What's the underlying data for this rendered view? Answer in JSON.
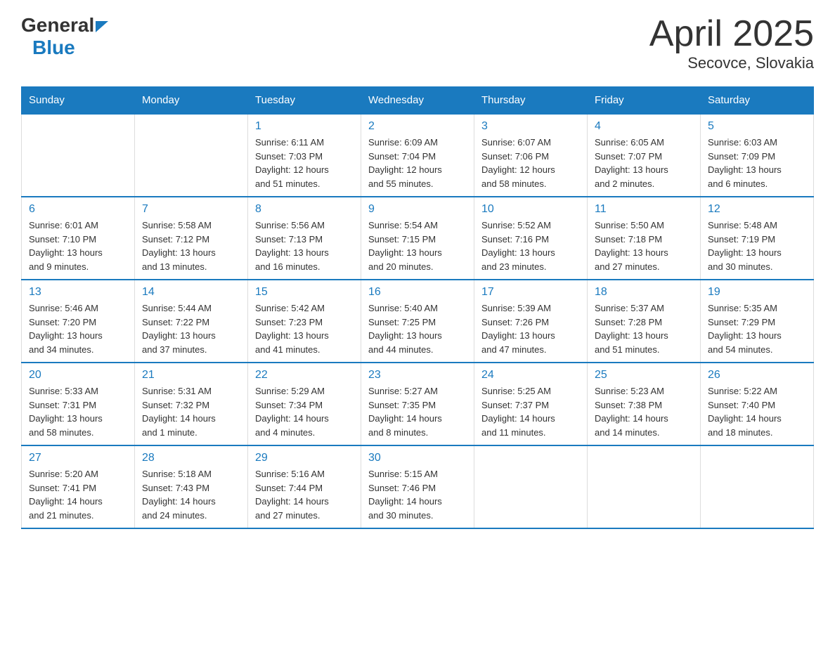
{
  "header": {
    "title": "April 2025",
    "subtitle": "Secovce, Slovakia",
    "logo_general": "General",
    "logo_blue": "Blue"
  },
  "days_of_week": [
    "Sunday",
    "Monday",
    "Tuesday",
    "Wednesday",
    "Thursday",
    "Friday",
    "Saturday"
  ],
  "weeks": [
    [
      {
        "day": "",
        "info": ""
      },
      {
        "day": "",
        "info": ""
      },
      {
        "day": "1",
        "info": "Sunrise: 6:11 AM\nSunset: 7:03 PM\nDaylight: 12 hours\nand 51 minutes."
      },
      {
        "day": "2",
        "info": "Sunrise: 6:09 AM\nSunset: 7:04 PM\nDaylight: 12 hours\nand 55 minutes."
      },
      {
        "day": "3",
        "info": "Sunrise: 6:07 AM\nSunset: 7:06 PM\nDaylight: 12 hours\nand 58 minutes."
      },
      {
        "day": "4",
        "info": "Sunrise: 6:05 AM\nSunset: 7:07 PM\nDaylight: 13 hours\nand 2 minutes."
      },
      {
        "day": "5",
        "info": "Sunrise: 6:03 AM\nSunset: 7:09 PM\nDaylight: 13 hours\nand 6 minutes."
      }
    ],
    [
      {
        "day": "6",
        "info": "Sunrise: 6:01 AM\nSunset: 7:10 PM\nDaylight: 13 hours\nand 9 minutes."
      },
      {
        "day": "7",
        "info": "Sunrise: 5:58 AM\nSunset: 7:12 PM\nDaylight: 13 hours\nand 13 minutes."
      },
      {
        "day": "8",
        "info": "Sunrise: 5:56 AM\nSunset: 7:13 PM\nDaylight: 13 hours\nand 16 minutes."
      },
      {
        "day": "9",
        "info": "Sunrise: 5:54 AM\nSunset: 7:15 PM\nDaylight: 13 hours\nand 20 minutes."
      },
      {
        "day": "10",
        "info": "Sunrise: 5:52 AM\nSunset: 7:16 PM\nDaylight: 13 hours\nand 23 minutes."
      },
      {
        "day": "11",
        "info": "Sunrise: 5:50 AM\nSunset: 7:18 PM\nDaylight: 13 hours\nand 27 minutes."
      },
      {
        "day": "12",
        "info": "Sunrise: 5:48 AM\nSunset: 7:19 PM\nDaylight: 13 hours\nand 30 minutes."
      }
    ],
    [
      {
        "day": "13",
        "info": "Sunrise: 5:46 AM\nSunset: 7:20 PM\nDaylight: 13 hours\nand 34 minutes."
      },
      {
        "day": "14",
        "info": "Sunrise: 5:44 AM\nSunset: 7:22 PM\nDaylight: 13 hours\nand 37 minutes."
      },
      {
        "day": "15",
        "info": "Sunrise: 5:42 AM\nSunset: 7:23 PM\nDaylight: 13 hours\nand 41 minutes."
      },
      {
        "day": "16",
        "info": "Sunrise: 5:40 AM\nSunset: 7:25 PM\nDaylight: 13 hours\nand 44 minutes."
      },
      {
        "day": "17",
        "info": "Sunrise: 5:39 AM\nSunset: 7:26 PM\nDaylight: 13 hours\nand 47 minutes."
      },
      {
        "day": "18",
        "info": "Sunrise: 5:37 AM\nSunset: 7:28 PM\nDaylight: 13 hours\nand 51 minutes."
      },
      {
        "day": "19",
        "info": "Sunrise: 5:35 AM\nSunset: 7:29 PM\nDaylight: 13 hours\nand 54 minutes."
      }
    ],
    [
      {
        "day": "20",
        "info": "Sunrise: 5:33 AM\nSunset: 7:31 PM\nDaylight: 13 hours\nand 58 minutes."
      },
      {
        "day": "21",
        "info": "Sunrise: 5:31 AM\nSunset: 7:32 PM\nDaylight: 14 hours\nand 1 minute."
      },
      {
        "day": "22",
        "info": "Sunrise: 5:29 AM\nSunset: 7:34 PM\nDaylight: 14 hours\nand 4 minutes."
      },
      {
        "day": "23",
        "info": "Sunrise: 5:27 AM\nSunset: 7:35 PM\nDaylight: 14 hours\nand 8 minutes."
      },
      {
        "day": "24",
        "info": "Sunrise: 5:25 AM\nSunset: 7:37 PM\nDaylight: 14 hours\nand 11 minutes."
      },
      {
        "day": "25",
        "info": "Sunrise: 5:23 AM\nSunset: 7:38 PM\nDaylight: 14 hours\nand 14 minutes."
      },
      {
        "day": "26",
        "info": "Sunrise: 5:22 AM\nSunset: 7:40 PM\nDaylight: 14 hours\nand 18 minutes."
      }
    ],
    [
      {
        "day": "27",
        "info": "Sunrise: 5:20 AM\nSunset: 7:41 PM\nDaylight: 14 hours\nand 21 minutes."
      },
      {
        "day": "28",
        "info": "Sunrise: 5:18 AM\nSunset: 7:43 PM\nDaylight: 14 hours\nand 24 minutes."
      },
      {
        "day": "29",
        "info": "Sunrise: 5:16 AM\nSunset: 7:44 PM\nDaylight: 14 hours\nand 27 minutes."
      },
      {
        "day": "30",
        "info": "Sunrise: 5:15 AM\nSunset: 7:46 PM\nDaylight: 14 hours\nand 30 minutes."
      },
      {
        "day": "",
        "info": ""
      },
      {
        "day": "",
        "info": ""
      },
      {
        "day": "",
        "info": ""
      }
    ]
  ]
}
